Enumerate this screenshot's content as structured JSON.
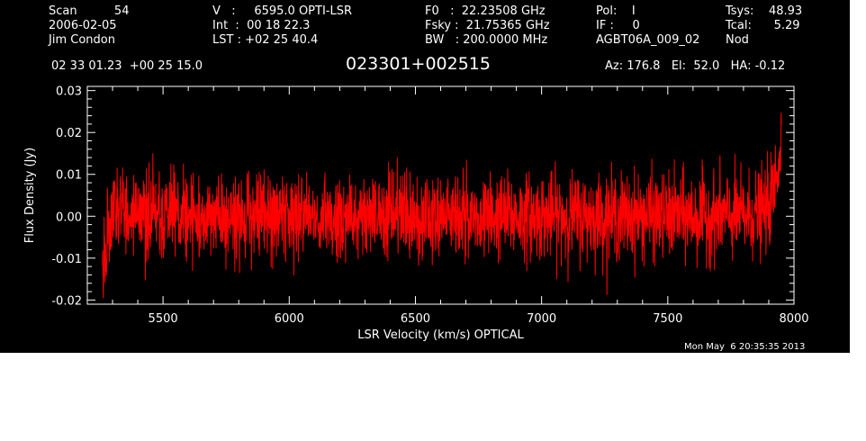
{
  "header": {
    "col1": [
      "Scan          54",
      "2006-02-05",
      "Jim Condon"
    ],
    "col2": [
      "V   :     6595.0 OPTI-LSR",
      "Int  :  00 18 22.3",
      "LST : +02 25 40.4"
    ],
    "col3": [
      "F0   :  22.23508 GHz",
      "Fsky :  21.75365 GHz",
      "BW   : 200.0000 MHz"
    ],
    "col4": [
      "Pol:    I",
      "IF :     0",
      "AGBT06A_009_02"
    ],
    "col5": [
      "Tsys:    48.93",
      "Tcal:      5.29",
      "Nod"
    ],
    "coords": "02 33 01.23  +00 25 15.0",
    "source": "023301+002515",
    "azel": "Az: 176.8   El:  52.0   HA: -0.12"
  },
  "timestamp": "Mon May  6 20:35:35 2013",
  "colors": {
    "background": "#000000",
    "trace": "#ff0000",
    "axes": "#ffffff"
  },
  "chart_data": {
    "type": "line",
    "xlabel": "LSR Velocity (km/s) OPTICAL",
    "ylabel": "Flux Density (Jy)",
    "xlim": [
      5200,
      8000
    ],
    "ylim": [
      -0.021,
      0.031
    ],
    "xticks": [
      5500,
      6000,
      6500,
      7000,
      7500,
      8000
    ],
    "xtick_labels": [
      "5500",
      "6000",
      "6500",
      "7000",
      "7500",
      "8000"
    ],
    "yticks": [
      -0.02,
      -0.01,
      0.0,
      0.01,
      0.02,
      0.03
    ],
    "ytick_labels": [
      "-0.02",
      "-0.01",
      "0.00",
      "0.01",
      "0.02",
      "0.03"
    ],
    "grid": false,
    "series": [
      {
        "noise_sigma_jy": 0.005,
        "x": [
          5260,
          5280,
          5300,
          5320,
          5400,
          5500,
          5600,
          5700,
          5800,
          5900,
          6000,
          6100,
          6200,
          6300,
          6400,
          6500,
          6600,
          6700,
          6800,
          6900,
          7000,
          7100,
          7200,
          7300,
          7400,
          7500,
          7600,
          7700,
          7800,
          7880,
          7900,
          7920,
          7940,
          7950
        ],
        "y": [
          -0.013,
          -0.006,
          0.003,
          0.001,
          0.001,
          0.0,
          0.0,
          0.0,
          0.0,
          0.0,
          0.0,
          0.0,
          -0.001,
          0.0,
          0.0,
          0.0,
          0.0,
          0.0,
          0.0,
          0.0,
          0.0,
          0.0,
          0.0,
          0.0,
          0.0,
          0.0,
          0.0,
          0.0,
          0.0,
          0.001,
          0.003,
          0.006,
          0.014,
          0.02
        ]
      }
    ]
  }
}
